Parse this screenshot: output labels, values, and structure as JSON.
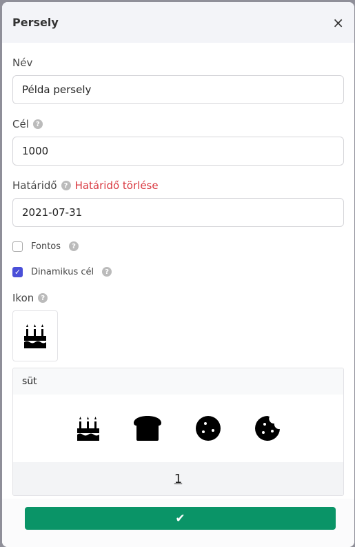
{
  "modal": {
    "title": "Persely",
    "close_icon": "×"
  },
  "form": {
    "name_label": "Név",
    "name_value": "Példa persely",
    "goal_label": "Cél",
    "goal_value": "1000",
    "deadline_label": "Határidő",
    "deadline_clear": "Határidő törlése",
    "deadline_value": "2021-07-31",
    "important_label": "Fontos",
    "important_checked": false,
    "dynamic_label": "Dinamikus cél",
    "dynamic_checked": true,
    "icon_label": "Ikon",
    "help": "?"
  },
  "picker": {
    "search_value": "süt",
    "icons": [
      "birthday-cake",
      "bread-slice",
      "cookie",
      "cookie-bite"
    ],
    "page": "1"
  },
  "submit": {
    "icon": "✔"
  },
  "colors": {
    "accent": "#4a4fd8",
    "danger": "#d9363e",
    "success": "#0a9467"
  }
}
